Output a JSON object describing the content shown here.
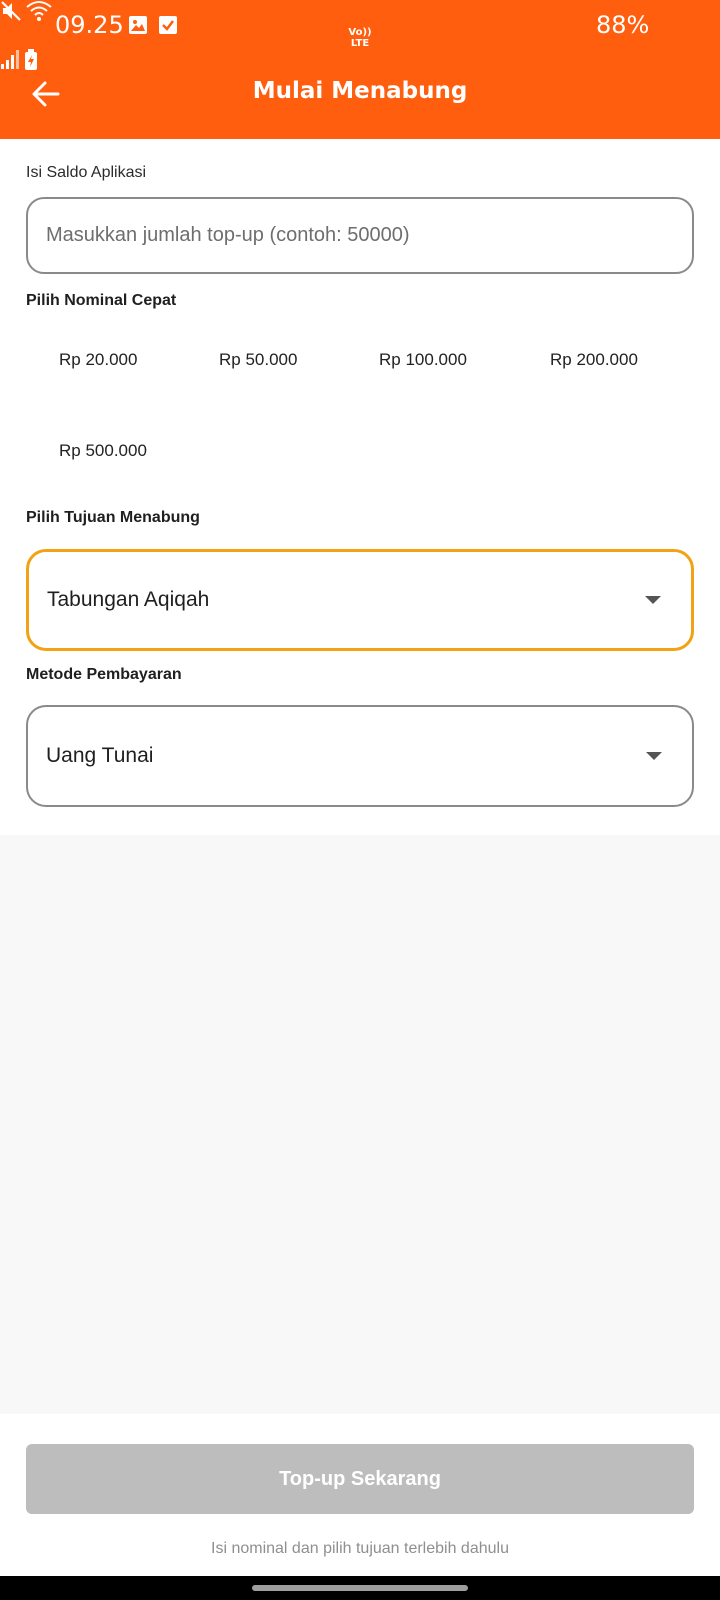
{
  "status_bar": {
    "time": "09.25",
    "battery": "88%",
    "icons": [
      "image-icon",
      "check-box-icon",
      "mute-icon",
      "wifi-icon",
      "volte-icon",
      "signal-icon",
      "battery-charging-icon"
    ],
    "volte_text_top": "Vo))",
    "volte_text_bottom": "LTE"
  },
  "app_bar": {
    "title": "Mulai Menabung",
    "back_icon": "arrow-left-icon"
  },
  "form": {
    "topup_label": "Isi Saldo Aplikasi",
    "topup_value": "",
    "topup_placeholder": "Masukkan jumlah top-up (contoh: 50000)",
    "quick_label": "Pilih Nominal Cepat",
    "quick_amounts": [
      "Rp 20.000",
      "Rp 50.000",
      "Rp 100.000",
      "Rp 200.000",
      "Rp 500.000"
    ],
    "goal_label": "Pilih Tujuan Menabung",
    "goal_value": "Tabungan Aqiqah",
    "payment_label": "Metode Pembayaran",
    "payment_value": "Uang Tunai"
  },
  "footer": {
    "button_label": "Top-up Sekarang",
    "hint": "Isi nominal dan pilih tujuan terlebih dahulu"
  },
  "colors": {
    "brand": "#ff5e0f",
    "focus_border": "#f2a215",
    "disabled_button": "#bdbdbd"
  }
}
